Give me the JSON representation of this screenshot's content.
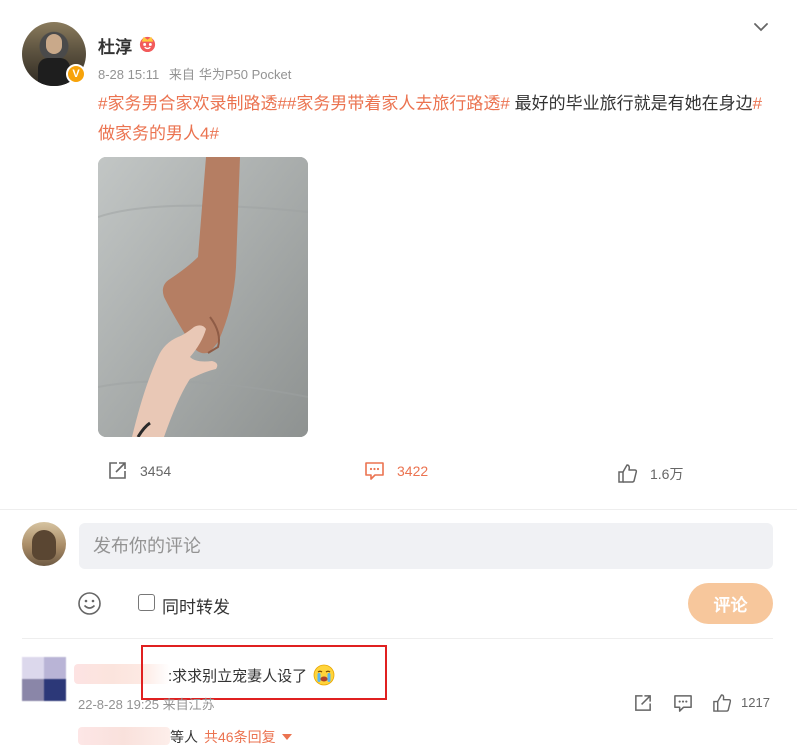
{
  "post": {
    "author": "杜淳",
    "time": "8-28 15:11",
    "source_prefix": "来自",
    "source_device": "华为P50 Pocket",
    "hashtag_1": "#家务男合家欢录制路透#",
    "hashtag_2": "#家务男带着家人去旅行路透#",
    "text_plain": " 最好的毕业旅行就是有她在身边",
    "hashtag_3": "#做家务的男人4#",
    "image": "hands-photo"
  },
  "actions": {
    "reposts": "3454",
    "comments": "3422",
    "likes": "1.6万"
  },
  "composer": {
    "placeholder": "发布你的评论",
    "repost_label": "同时转发",
    "submit_label": "评论"
  },
  "comment": {
    "text": ":求求别立宠妻人设了",
    "time": "22-8-28 19:25 来自江苏",
    "likes": "1217"
  },
  "replies": {
    "suffix": "等人",
    "count_label": "共46条回复"
  },
  "colors": {
    "accent": "#eb7350",
    "submit_button": "#f7c79c",
    "highlight_box": "#e02020"
  },
  "icons": [
    "chevron-down-icon",
    "crown-icon",
    "verified-icon",
    "repost-icon",
    "comment-icon",
    "like-icon",
    "emoji-icon",
    "cry-emoji-icon",
    "caret-down-icon"
  ]
}
